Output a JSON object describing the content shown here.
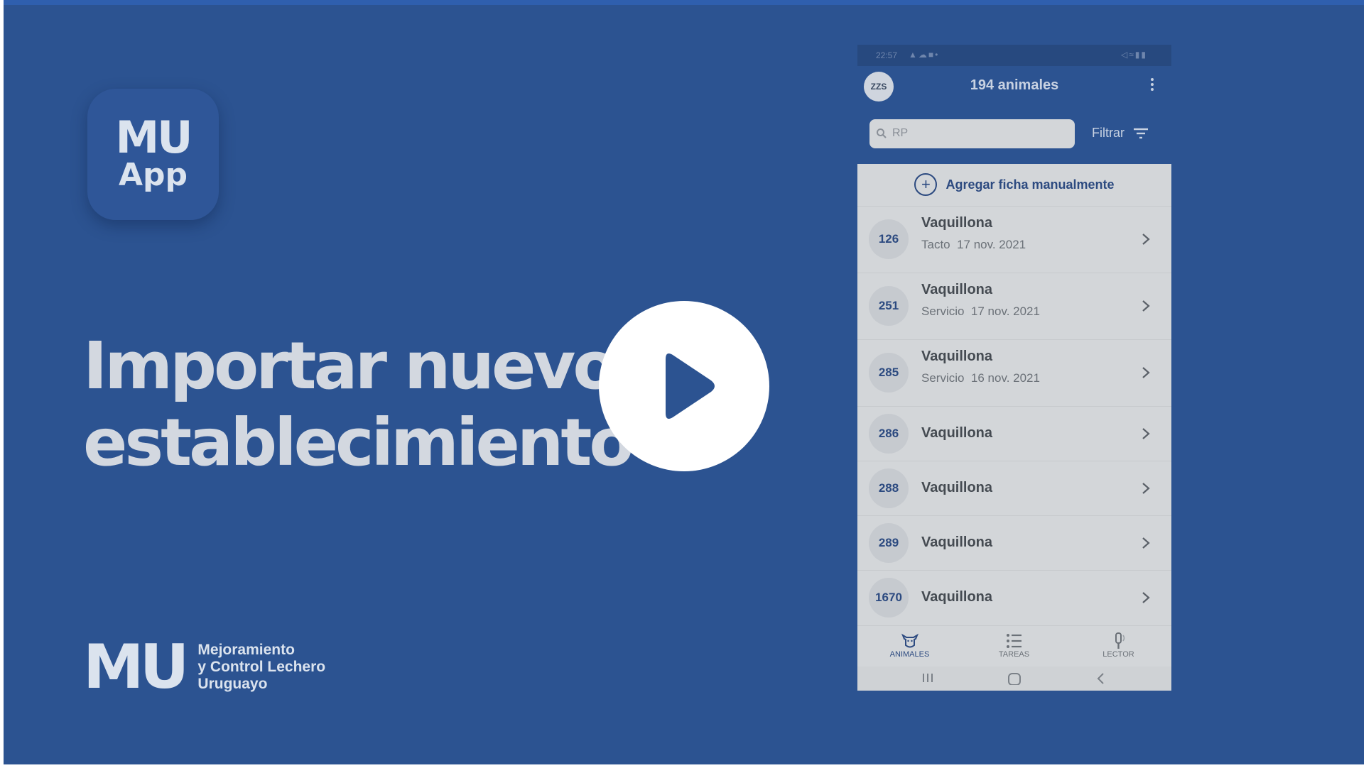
{
  "app_icon": {
    "line1": "MU",
    "line2": "App"
  },
  "headline": {
    "line1": "Importar nuevo",
    "line2": "establecimiento"
  },
  "footer_logo": {
    "mark": "MU",
    "line1": "Mejoramiento",
    "line2": "y Control Lechero",
    "line3": "Uruguayo"
  },
  "phone": {
    "status_time": "22:57",
    "avatar": "ZZS",
    "title": "194 animales",
    "search_placeholder": "RP",
    "filter_label": "Filtrar",
    "add_manual": "Agregar ficha manualmente",
    "animals": [
      {
        "id": "126",
        "name": "Vaquillona",
        "detail": "Tacto  17 nov. 2021"
      },
      {
        "id": "251",
        "name": "Vaquillona",
        "detail": "Servicio  17 nov. 2021"
      },
      {
        "id": "285",
        "name": "Vaquillona",
        "detail": "Servicio  16 nov. 2021"
      },
      {
        "id": "286",
        "name": "Vaquillona",
        "detail": ""
      },
      {
        "id": "288",
        "name": "Vaquillona",
        "detail": ""
      },
      {
        "id": "289",
        "name": "Vaquillona",
        "detail": ""
      },
      {
        "id": "1670",
        "name": "Vaquillona",
        "detail": ""
      }
    ],
    "nav": {
      "animals": "ANIMALES",
      "tasks": "TAREAS",
      "reader": "LECTOR"
    }
  },
  "colors": {
    "background": "#2c5391",
    "phone_list": "#d3d6d9",
    "accent_text": "#2c4a80",
    "play_button": "#ffffff"
  }
}
